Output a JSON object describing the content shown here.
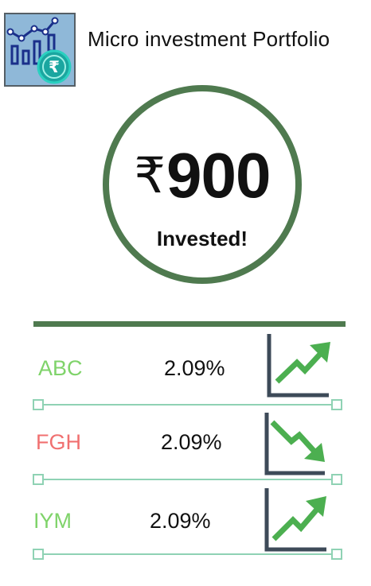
{
  "header": {
    "title": "Micro investment Portfolio",
    "icon": "investment-chart-rupee-icon"
  },
  "summary": {
    "currency": "₹",
    "amount": "900",
    "label": "Invested!"
  },
  "colors": {
    "accent": "#4f7a4f",
    "gain": "#7fd36a",
    "loss": "#f07070",
    "slider": "#8fd2b4",
    "trend_up": "#4caf50",
    "axis": "#3d4a58"
  },
  "stocks": [
    {
      "ticker": "ABC",
      "change": "2.09%",
      "trend": "up",
      "trend_icon": "trend-up-icon"
    },
    {
      "ticker": "FGH",
      "change": "2.09%",
      "trend": "down",
      "trend_icon": "trend-down-icon"
    },
    {
      "ticker": "IYM",
      "change": "2.09%",
      "trend": "up",
      "trend_icon": "trend-up-icon"
    }
  ]
}
